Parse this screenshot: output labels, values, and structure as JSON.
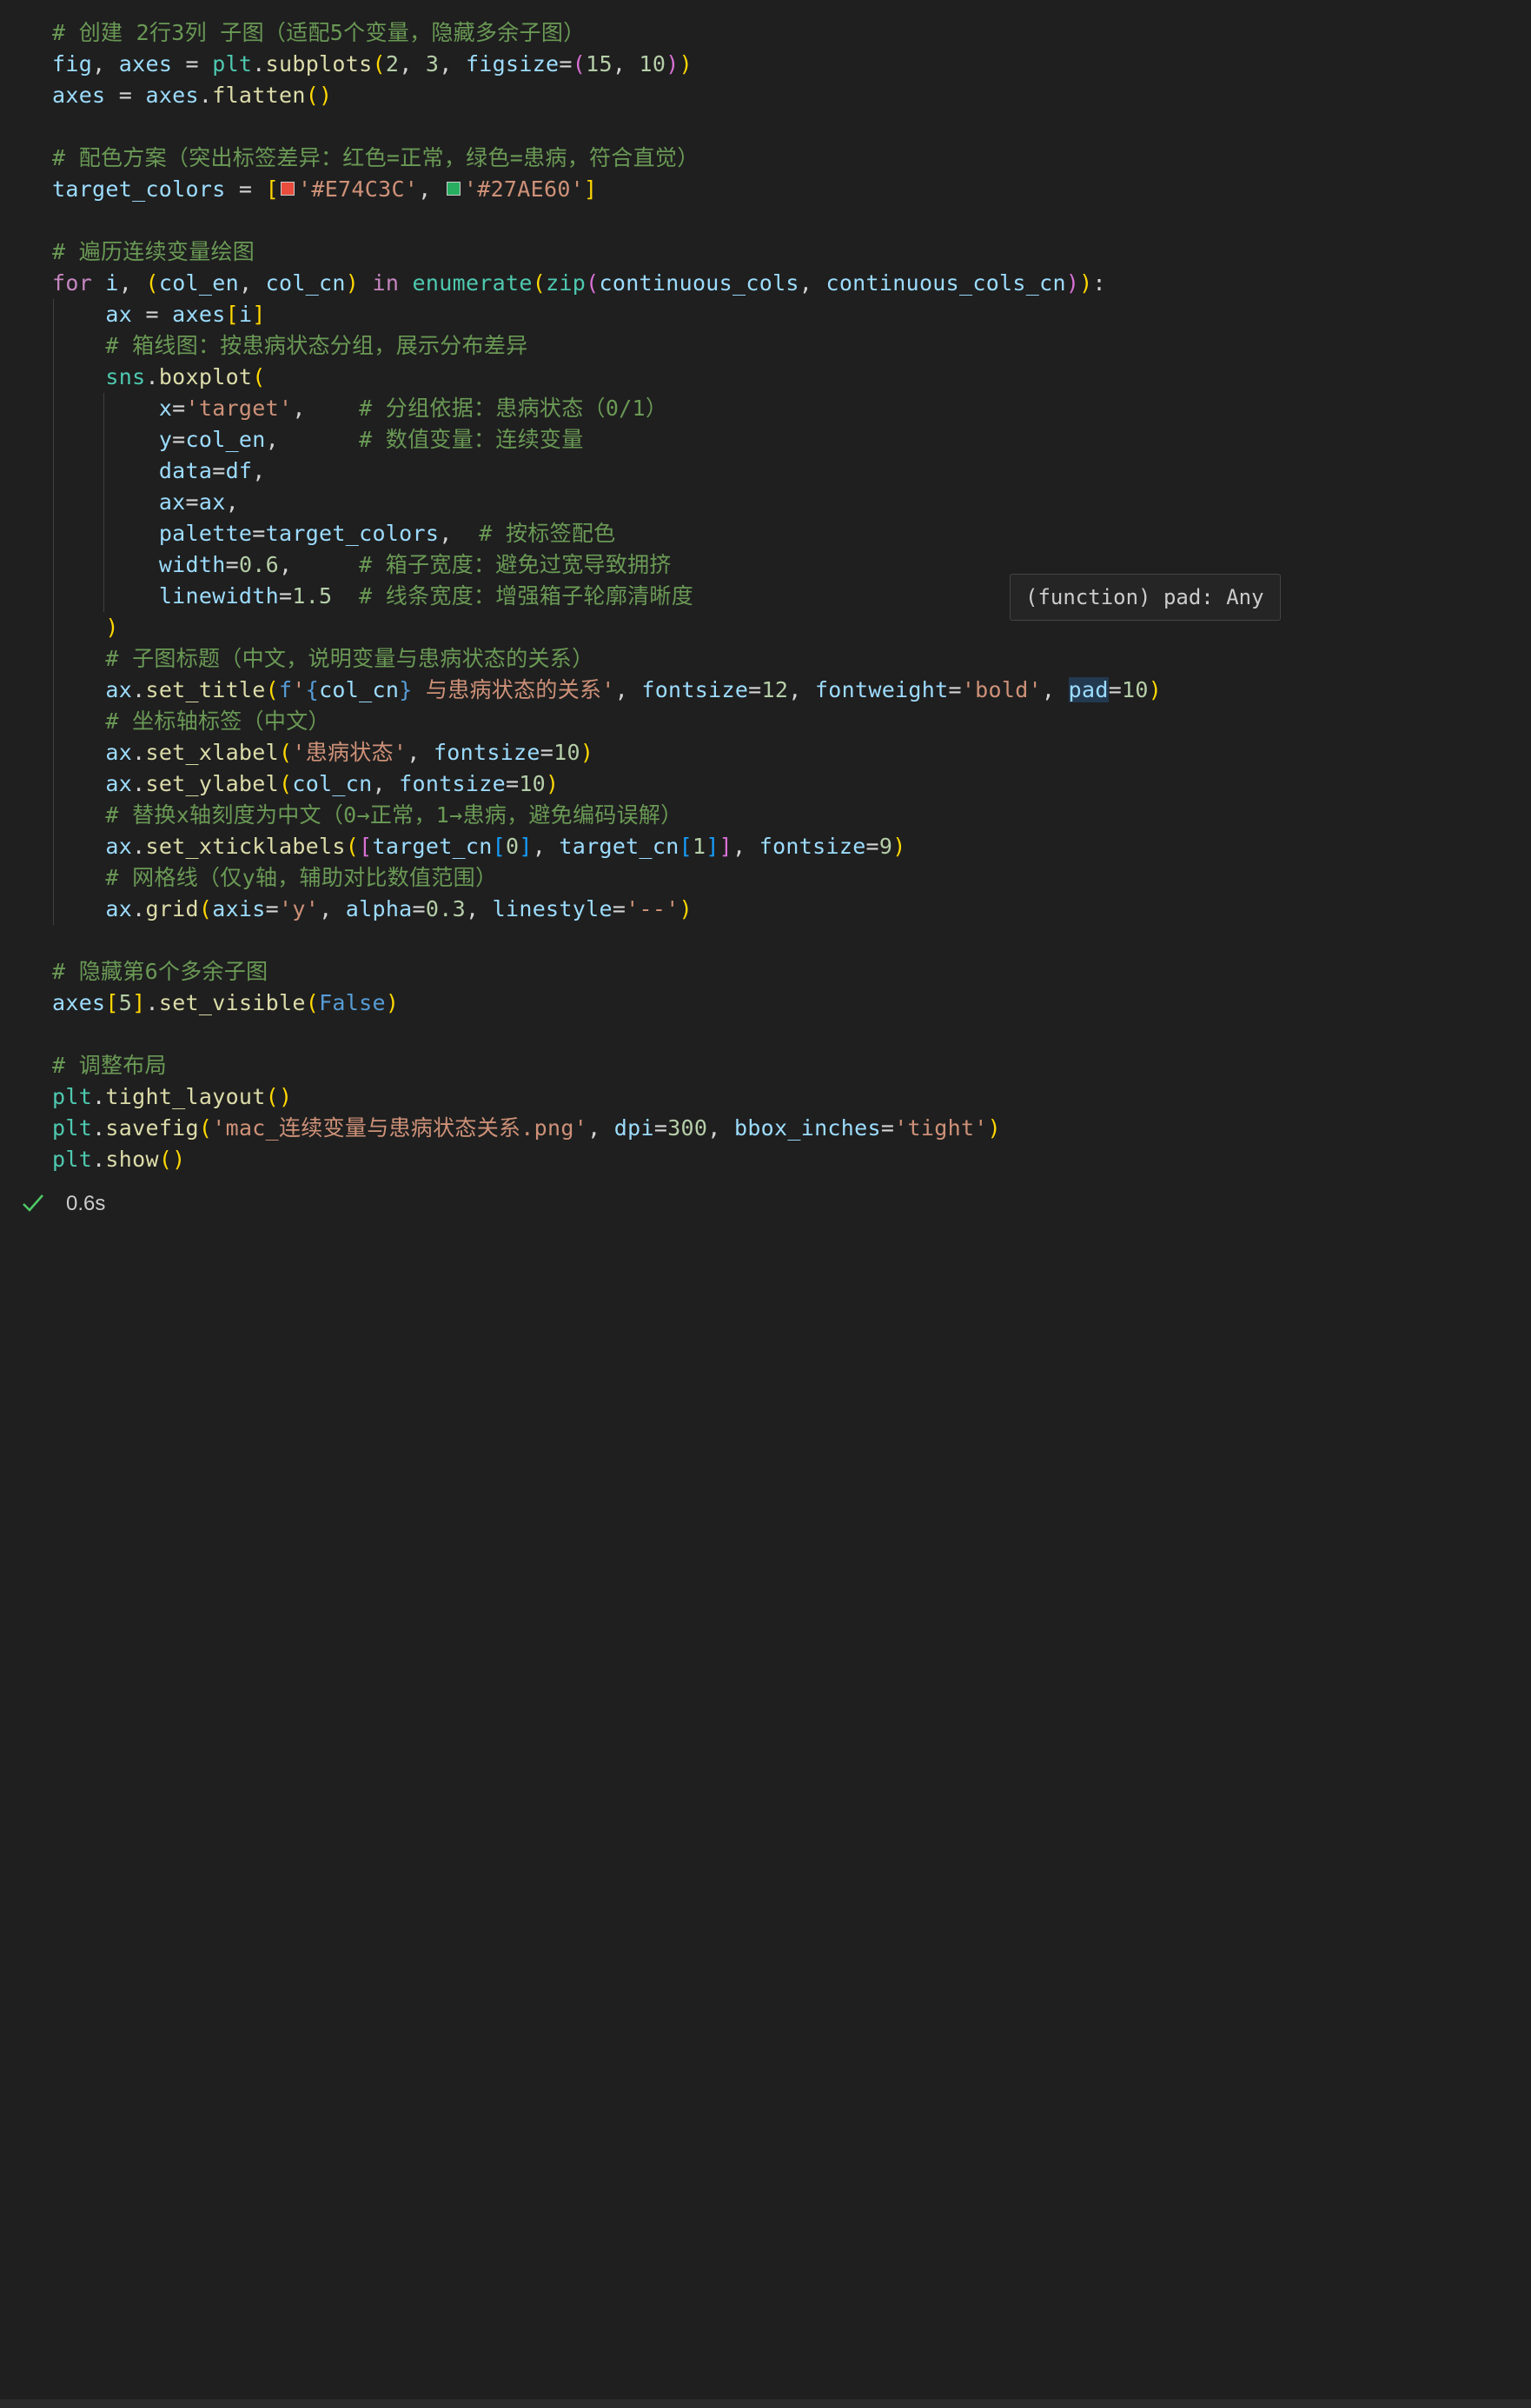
{
  "code": {
    "lines": [
      {
        "tokens": [
          {
            "t": "# 创建 2行3列 子图（适配5个变量，隐藏多余子图）",
            "c": "com"
          }
        ]
      },
      {
        "tokens": [
          {
            "t": "fig",
            "c": "var"
          },
          {
            "t": ", ",
            "c": "op"
          },
          {
            "t": "axes",
            "c": "var"
          },
          {
            "t": " = ",
            "c": "op"
          },
          {
            "t": "plt",
            "c": "mod"
          },
          {
            "t": ".",
            "c": "op"
          },
          {
            "t": "subplots",
            "c": "fn"
          },
          {
            "t": "(",
            "c": "b1"
          },
          {
            "t": "2",
            "c": "num"
          },
          {
            "t": ", ",
            "c": "op"
          },
          {
            "t": "3",
            "c": "num"
          },
          {
            "t": ", ",
            "c": "op"
          },
          {
            "t": "figsize",
            "c": "var"
          },
          {
            "t": "=",
            "c": "op"
          },
          {
            "t": "(",
            "c": "b2"
          },
          {
            "t": "15",
            "c": "num"
          },
          {
            "t": ", ",
            "c": "op"
          },
          {
            "t": "10",
            "c": "num"
          },
          {
            "t": ")",
            "c": "b2"
          },
          {
            "t": ")",
            "c": "b1"
          }
        ]
      },
      {
        "tokens": [
          {
            "t": "axes",
            "c": "var"
          },
          {
            "t": " = ",
            "c": "op"
          },
          {
            "t": "axes",
            "c": "var"
          },
          {
            "t": ".",
            "c": "op"
          },
          {
            "t": "flatten",
            "c": "fn"
          },
          {
            "t": "()",
            "c": "b1"
          }
        ]
      },
      {
        "tokens": []
      },
      {
        "tokens": [
          {
            "t": "# 配色方案（突出标签差异：红色=正常，绿色=患病，符合直觉）",
            "c": "com"
          }
        ]
      },
      {
        "tokens": [
          {
            "t": "target_colors",
            "c": "var"
          },
          {
            "t": " = ",
            "c": "op"
          },
          {
            "t": "[",
            "c": "b1"
          },
          {
            "swatch": "#E74C3C"
          },
          {
            "t": "'#E74C3C'",
            "c": "str"
          },
          {
            "t": ", ",
            "c": "op"
          },
          {
            "swatch": "#27AE60"
          },
          {
            "t": "'#27AE60'",
            "c": "str"
          },
          {
            "t": "]",
            "c": "b1"
          }
        ]
      },
      {
        "tokens": []
      },
      {
        "tokens": [
          {
            "t": "# 遍历连续变量绘图",
            "c": "com"
          }
        ]
      },
      {
        "tokens": [
          {
            "t": "for",
            "c": "kw"
          },
          {
            "t": " ",
            "c": "op"
          },
          {
            "t": "i",
            "c": "var"
          },
          {
            "t": ", ",
            "c": "op"
          },
          {
            "t": "(",
            "c": "b1"
          },
          {
            "t": "col_en",
            "c": "var"
          },
          {
            "t": ", ",
            "c": "op"
          },
          {
            "t": "col_cn",
            "c": "var"
          },
          {
            "t": ")",
            "c": "b1"
          },
          {
            "t": " ",
            "c": "op"
          },
          {
            "t": "in",
            "c": "kw"
          },
          {
            "t": " ",
            "c": "op"
          },
          {
            "t": "enumerate",
            "c": "mod"
          },
          {
            "t": "(",
            "c": "b1"
          },
          {
            "t": "zip",
            "c": "mod"
          },
          {
            "t": "(",
            "c": "b2"
          },
          {
            "t": "continuous_cols",
            "c": "var"
          },
          {
            "t": ", ",
            "c": "op"
          },
          {
            "t": "continuous_cols_cn",
            "c": "var"
          },
          {
            "t": ")",
            "c": "b2"
          },
          {
            "t": ")",
            "c": "b1"
          },
          {
            "t": ":",
            "c": "op"
          }
        ]
      },
      {
        "tokens": [
          {
            "t": "    ",
            "c": "op"
          },
          {
            "t": "ax",
            "c": "var"
          },
          {
            "t": " = ",
            "c": "op"
          },
          {
            "t": "axes",
            "c": "var"
          },
          {
            "t": "[",
            "c": "b1"
          },
          {
            "t": "i",
            "c": "var"
          },
          {
            "t": "]",
            "c": "b1"
          }
        ]
      },
      {
        "tokens": [
          {
            "t": "    ",
            "c": "op"
          },
          {
            "t": "# 箱线图：按患病状态分组，展示分布差异",
            "c": "com"
          }
        ]
      },
      {
        "tokens": [
          {
            "t": "    ",
            "c": "op"
          },
          {
            "t": "sns",
            "c": "mod"
          },
          {
            "t": ".",
            "c": "op"
          },
          {
            "t": "boxplot",
            "c": "fn"
          },
          {
            "t": "(",
            "c": "b1"
          }
        ]
      },
      {
        "tokens": [
          {
            "t": "        ",
            "c": "op"
          },
          {
            "t": "x",
            "c": "var"
          },
          {
            "t": "=",
            "c": "op"
          },
          {
            "t": "'target'",
            "c": "str"
          },
          {
            "t": ",    ",
            "c": "op"
          },
          {
            "t": "# 分组依据：患病状态（0/1）",
            "c": "com"
          }
        ]
      },
      {
        "tokens": [
          {
            "t": "        ",
            "c": "op"
          },
          {
            "t": "y",
            "c": "var"
          },
          {
            "t": "=",
            "c": "op"
          },
          {
            "t": "col_en",
            "c": "var"
          },
          {
            "t": ",      ",
            "c": "op"
          },
          {
            "t": "# 数值变量：连续变量",
            "c": "com"
          }
        ]
      },
      {
        "tokens": [
          {
            "t": "        ",
            "c": "op"
          },
          {
            "t": "data",
            "c": "var"
          },
          {
            "t": "=",
            "c": "op"
          },
          {
            "t": "df",
            "c": "var"
          },
          {
            "t": ",",
            "c": "op"
          }
        ]
      },
      {
        "tokens": [
          {
            "t": "        ",
            "c": "op"
          },
          {
            "t": "ax",
            "c": "var"
          },
          {
            "t": "=",
            "c": "op"
          },
          {
            "t": "ax",
            "c": "var"
          },
          {
            "t": ",",
            "c": "op"
          }
        ]
      },
      {
        "tokens": [
          {
            "t": "        ",
            "c": "op"
          },
          {
            "t": "palette",
            "c": "var"
          },
          {
            "t": "=",
            "c": "op"
          },
          {
            "t": "target_colors",
            "c": "var"
          },
          {
            "t": ",  ",
            "c": "op"
          },
          {
            "t": "# 按标签配色",
            "c": "com"
          }
        ]
      },
      {
        "tokens": [
          {
            "t": "        ",
            "c": "op"
          },
          {
            "t": "width",
            "c": "var"
          },
          {
            "t": "=",
            "c": "op"
          },
          {
            "t": "0.6",
            "c": "num"
          },
          {
            "t": ",     ",
            "c": "op"
          },
          {
            "t": "# 箱子宽度：避免过宽导致拥挤",
            "c": "com"
          }
        ]
      },
      {
        "tokens": [
          {
            "t": "        ",
            "c": "op"
          },
          {
            "t": "linewidth",
            "c": "var"
          },
          {
            "t": "=",
            "c": "op"
          },
          {
            "t": "1.5",
            "c": "num"
          },
          {
            "t": "  ",
            "c": "op"
          },
          {
            "t": "# 线条宽度：增强箱子轮廓清晰度",
            "c": "com"
          }
        ]
      },
      {
        "tokens": [
          {
            "t": "    ",
            "c": "op"
          },
          {
            "t": ")",
            "c": "b1"
          }
        ]
      },
      {
        "tokens": [
          {
            "t": "    ",
            "c": "op"
          },
          {
            "t": "# 子图标题（中文，说明变量与患病状态的关系）",
            "c": "com"
          }
        ]
      },
      {
        "tokens": [
          {
            "t": "    ",
            "c": "op"
          },
          {
            "t": "ax",
            "c": "var"
          },
          {
            "t": ".",
            "c": "op"
          },
          {
            "t": "set_title",
            "c": "fn"
          },
          {
            "t": "(",
            "c": "b1"
          },
          {
            "t": "f",
            "c": "bool"
          },
          {
            "t": "'",
            "c": "str"
          },
          {
            "t": "{",
            "c": "bool"
          },
          {
            "t": "col_cn",
            "c": "var"
          },
          {
            "t": "}",
            "c": "bool"
          },
          {
            "t": " 与患病状态的关系'",
            "c": "str"
          },
          {
            "t": ", ",
            "c": "op"
          },
          {
            "t": "fontsize",
            "c": "var"
          },
          {
            "t": "=",
            "c": "op"
          },
          {
            "t": "12",
            "c": "num"
          },
          {
            "t": ", ",
            "c": "op"
          },
          {
            "t": "fontweight",
            "c": "var"
          },
          {
            "t": "=",
            "c": "op"
          },
          {
            "t": "'bold'",
            "c": "str"
          },
          {
            "t": ", ",
            "c": "op"
          },
          {
            "t": "pad",
            "c": "var",
            "hl": true
          },
          {
            "t": "=",
            "c": "op"
          },
          {
            "t": "10",
            "c": "num"
          },
          {
            "t": ")",
            "c": "b1"
          }
        ]
      },
      {
        "tokens": [
          {
            "t": "    ",
            "c": "op"
          },
          {
            "t": "# 坐标轴标签（中文）",
            "c": "com"
          }
        ]
      },
      {
        "tokens": [
          {
            "t": "    ",
            "c": "op"
          },
          {
            "t": "ax",
            "c": "var"
          },
          {
            "t": ".",
            "c": "op"
          },
          {
            "t": "set_xlabel",
            "c": "fn"
          },
          {
            "t": "(",
            "c": "b1"
          },
          {
            "t": "'患病状态'",
            "c": "str"
          },
          {
            "t": ", ",
            "c": "op"
          },
          {
            "t": "fontsize",
            "c": "var"
          },
          {
            "t": "=",
            "c": "op"
          },
          {
            "t": "10",
            "c": "num"
          },
          {
            "t": ")",
            "c": "b1"
          }
        ]
      },
      {
        "tokens": [
          {
            "t": "    ",
            "c": "op"
          },
          {
            "t": "ax",
            "c": "var"
          },
          {
            "t": ".",
            "c": "op"
          },
          {
            "t": "set_ylabel",
            "c": "fn"
          },
          {
            "t": "(",
            "c": "b1"
          },
          {
            "t": "col_cn",
            "c": "var"
          },
          {
            "t": ", ",
            "c": "op"
          },
          {
            "t": "fontsize",
            "c": "var"
          },
          {
            "t": "=",
            "c": "op"
          },
          {
            "t": "10",
            "c": "num"
          },
          {
            "t": ")",
            "c": "b1"
          }
        ]
      },
      {
        "tokens": [
          {
            "t": "    ",
            "c": "op"
          },
          {
            "t": "# 替换x轴刻度为中文（0→正常，1→患病，避免编码误解）",
            "c": "com"
          }
        ]
      },
      {
        "tokens": [
          {
            "t": "    ",
            "c": "op"
          },
          {
            "t": "ax",
            "c": "var"
          },
          {
            "t": ".",
            "c": "op"
          },
          {
            "t": "set_xticklabels",
            "c": "fn"
          },
          {
            "t": "(",
            "c": "b1"
          },
          {
            "t": "[",
            "c": "b2"
          },
          {
            "t": "target_cn",
            "c": "var"
          },
          {
            "t": "[",
            "c": "b3"
          },
          {
            "t": "0",
            "c": "num"
          },
          {
            "t": "]",
            "c": "b3"
          },
          {
            "t": ", ",
            "c": "op"
          },
          {
            "t": "target_cn",
            "c": "var"
          },
          {
            "t": "[",
            "c": "b3"
          },
          {
            "t": "1",
            "c": "num"
          },
          {
            "t": "]",
            "c": "b3"
          },
          {
            "t": "]",
            "c": "b2"
          },
          {
            "t": ", ",
            "c": "op"
          },
          {
            "t": "fontsize",
            "c": "var"
          },
          {
            "t": "=",
            "c": "op"
          },
          {
            "t": "9",
            "c": "num"
          },
          {
            "t": ")",
            "c": "b1"
          }
        ]
      },
      {
        "tokens": [
          {
            "t": "    ",
            "c": "op"
          },
          {
            "t": "# 网格线（仅y轴，辅助对比数值范围）",
            "c": "com"
          }
        ]
      },
      {
        "tokens": [
          {
            "t": "    ",
            "c": "op"
          },
          {
            "t": "ax",
            "c": "var"
          },
          {
            "t": ".",
            "c": "op"
          },
          {
            "t": "grid",
            "c": "fn"
          },
          {
            "t": "(",
            "c": "b1"
          },
          {
            "t": "axis",
            "c": "var"
          },
          {
            "t": "=",
            "c": "op"
          },
          {
            "t": "'y'",
            "c": "str"
          },
          {
            "t": ", ",
            "c": "op"
          },
          {
            "t": "alpha",
            "c": "var"
          },
          {
            "t": "=",
            "c": "op"
          },
          {
            "t": "0.3",
            "c": "num"
          },
          {
            "t": ", ",
            "c": "op"
          },
          {
            "t": "linestyle",
            "c": "var"
          },
          {
            "t": "=",
            "c": "op"
          },
          {
            "t": "'--'",
            "c": "str"
          },
          {
            "t": ")",
            "c": "b1"
          }
        ]
      },
      {
        "tokens": []
      },
      {
        "tokens": [
          {
            "t": "# 隐藏第6个多余子图",
            "c": "com"
          }
        ]
      },
      {
        "tokens": [
          {
            "t": "axes",
            "c": "var"
          },
          {
            "t": "[",
            "c": "b1"
          },
          {
            "t": "5",
            "c": "num"
          },
          {
            "t": "]",
            "c": "b1"
          },
          {
            "t": ".",
            "c": "op"
          },
          {
            "t": "set_visible",
            "c": "fn"
          },
          {
            "t": "(",
            "c": "b1"
          },
          {
            "t": "False",
            "c": "bool"
          },
          {
            "t": ")",
            "c": "b1"
          }
        ]
      },
      {
        "tokens": []
      },
      {
        "tokens": [
          {
            "t": "# 调整布局",
            "c": "com"
          }
        ]
      },
      {
        "tokens": [
          {
            "t": "plt",
            "c": "mod"
          },
          {
            "t": ".",
            "c": "op"
          },
          {
            "t": "tight_layout",
            "c": "fn"
          },
          {
            "t": "()",
            "c": "b1"
          }
        ]
      },
      {
        "tokens": [
          {
            "t": "plt",
            "c": "mod"
          },
          {
            "t": ".",
            "c": "op"
          },
          {
            "t": "savefig",
            "c": "fn"
          },
          {
            "t": "(",
            "c": "b1"
          },
          {
            "t": "'mac_连续变量与患病状态关系.png'",
            "c": "str"
          },
          {
            "t": ", ",
            "c": "op"
          },
          {
            "t": "dpi",
            "c": "var"
          },
          {
            "t": "=",
            "c": "op"
          },
          {
            "t": "300",
            "c": "num"
          },
          {
            "t": ", ",
            "c": "op"
          },
          {
            "t": "bbox_inches",
            "c": "var"
          },
          {
            "t": "=",
            "c": "op"
          },
          {
            "t": "'tight'",
            "c": "str"
          },
          {
            "t": ")",
            "c": "b1"
          }
        ]
      },
      {
        "tokens": [
          {
            "t": "plt",
            "c": "mod"
          },
          {
            "t": ".",
            "c": "op"
          },
          {
            "t": "show",
            "c": "fn"
          },
          {
            "t": "()",
            "c": "b1"
          }
        ]
      }
    ]
  },
  "hover": {
    "text": "(function) pad: Any"
  },
  "status": {
    "icon": "check-icon",
    "exec_time": "0.6s"
  }
}
